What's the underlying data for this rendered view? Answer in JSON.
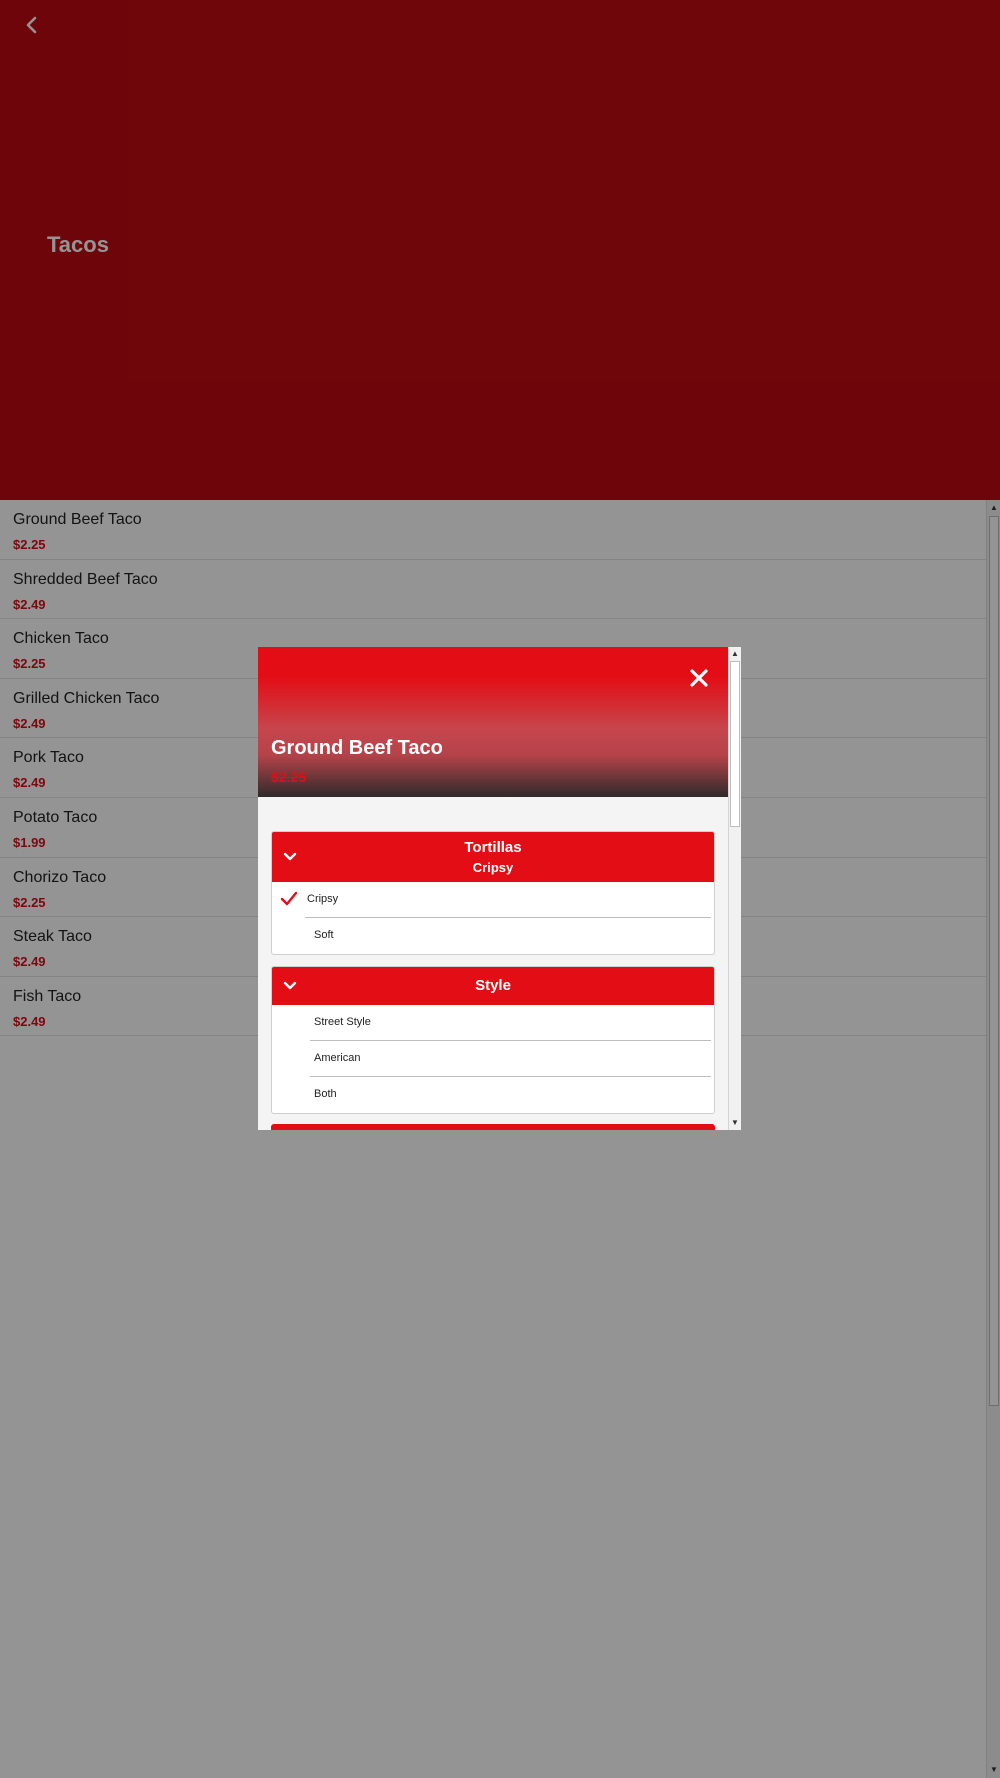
{
  "header": {
    "back_icon": "chevron-left-icon",
    "title": "Tacos"
  },
  "menu": {
    "items": [
      {
        "name": "Ground Beef Taco",
        "price": "$2.25"
      },
      {
        "name": "Shredded Beef Taco",
        "price": "$2.49"
      },
      {
        "name": "Chicken Taco",
        "price": "$2.25"
      },
      {
        "name": "Grilled Chicken Taco",
        "price": "$2.49"
      },
      {
        "name": "Pork Taco",
        "price": "$2.49"
      },
      {
        "name": "Potato Taco",
        "price": "$1.99"
      },
      {
        "name": "Chorizo Taco",
        "price": "$2.25"
      },
      {
        "name": "Steak Taco",
        "price": "$2.49"
      },
      {
        "name": "Fish Taco",
        "price": "$2.49"
      }
    ]
  },
  "modal": {
    "title": "Ground Beef Taco",
    "price": "$2.25",
    "close_icon": "close-icon",
    "groups": [
      {
        "name": "Tortillas",
        "selected": "Cripsy",
        "options": [
          {
            "label": "Cripsy",
            "checked": true
          },
          {
            "label": "Soft",
            "checked": false
          }
        ]
      },
      {
        "name": "Style",
        "selected": "",
        "options": [
          {
            "label": "Street Style",
            "checked": false
          },
          {
            "label": "American",
            "checked": false
          },
          {
            "label": "Both",
            "checked": false
          }
        ]
      }
    ]
  },
  "colors": {
    "brand_red": "#e30d16",
    "header_red": "#bd0a12",
    "price_red": "#d40f17"
  }
}
